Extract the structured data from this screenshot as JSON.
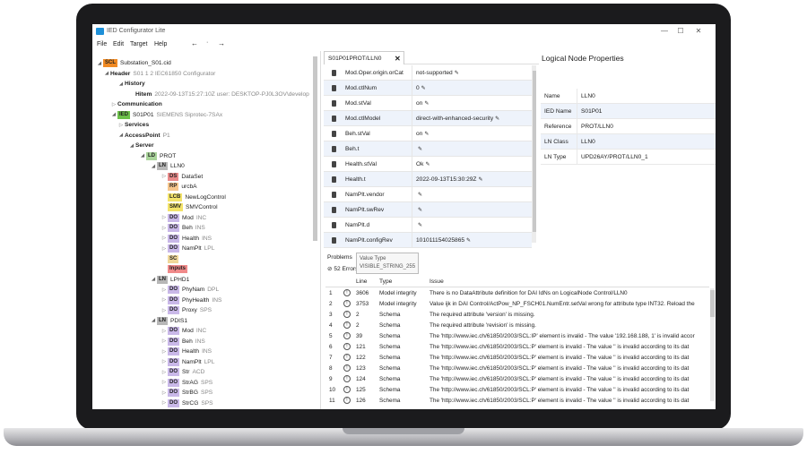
{
  "app": {
    "title": "IED Configurator Lite"
  },
  "window_controls": {
    "minimize": "—",
    "maximize": "☐",
    "close": "✕"
  },
  "menu": {
    "items": [
      "File",
      "Edit",
      "Target",
      "Help"
    ],
    "back": "←",
    "forward": "→"
  },
  "tree": [
    {
      "caret": "◢",
      "tag": "SCL",
      "tag_color": "#f08a24",
      "label": "Substation_S01.cid",
      "sub": "",
      "bold": false
    },
    {
      "caret": "◢",
      "tag": "",
      "tag_color": "",
      "label": "Header",
      "sub": "S01 1 2 IEC61850 Configurator",
      "bold": true
    },
    {
      "caret": "◢",
      "tag": "",
      "tag_color": "",
      "label": "History",
      "sub": "",
      "bold": true
    },
    {
      "caret": "",
      "tag": "",
      "tag_color": "",
      "label": "Hitem",
      "sub": "2022-09-13T15:27:10Z user: DESKTOP-PJ0L3OV\\develop",
      "bold": true
    },
    {
      "caret": "▷",
      "tag": "",
      "tag_color": "",
      "label": "Communication",
      "sub": "",
      "bold": true
    },
    {
      "caret": "◢",
      "tag": "IED",
      "tag_color": "#6cc04a",
      "label": "S01P01",
      "sub": "SIEMENS Siprotec-7SAx",
      "bold": false
    },
    {
      "caret": "▷",
      "tag": "",
      "tag_color": "",
      "label": "Services",
      "sub": "",
      "bold": true
    },
    {
      "caret": "◢",
      "tag": "",
      "tag_color": "",
      "label": "AccessPoint",
      "sub": "P1",
      "bold": true
    },
    {
      "caret": "◢",
      "tag": "",
      "tag_color": "",
      "label": "Server",
      "sub": "",
      "bold": true
    },
    {
      "caret": "◢",
      "tag": "LD",
      "tag_color": "#a9d49a",
      "label": "PROT",
      "sub": "",
      "bold": false
    },
    {
      "caret": "◢",
      "tag": "LN",
      "tag_color": "#b7b7b7",
      "label": "LLN0",
      "sub": "",
      "bold": false
    },
    {
      "caret": "▷",
      "tag": "DS",
      "tag_color": "#e98a8a",
      "label": "DataSet",
      "sub": "",
      "bold": false
    },
    {
      "caret": "",
      "tag": "RP",
      "tag_color": "#f6c68c",
      "label": "urcbA",
      "sub": "",
      "bold": false
    },
    {
      "caret": "",
      "tag": "LCB",
      "tag_color": "#f3e36a",
      "label": "NewLogControl",
      "sub": "",
      "bold": false
    },
    {
      "caret": "",
      "tag": "SMV",
      "tag_color": "#f3e36a",
      "label": "SMVControl",
      "sub": "",
      "bold": false
    },
    {
      "caret": "▷",
      "tag": "DO",
      "tag_color": "#c9b8e8",
      "label": "Mod",
      "sub": "INC",
      "bold": false
    },
    {
      "caret": "▷",
      "tag": "DO",
      "tag_color": "#c9b8e8",
      "label": "Beh",
      "sub": "INS",
      "bold": false
    },
    {
      "caret": "▷",
      "tag": "DO",
      "tag_color": "#c9b8e8",
      "label": "Health",
      "sub": "INS",
      "bold": false
    },
    {
      "caret": "▷",
      "tag": "DO",
      "tag_color": "#c9b8e8",
      "label": "NamPlt",
      "sub": "LPL",
      "bold": false
    },
    {
      "caret": "",
      "tag": "SC",
      "tag_color": "#f0d89a",
      "label": "",
      "sub": "",
      "bold": false
    },
    {
      "caret": "",
      "tag": "Inputs",
      "tag_color": "#f08a8a",
      "label": "",
      "sub": "",
      "bold": false
    },
    {
      "caret": "◢",
      "tag": "LN",
      "tag_color": "#b7b7b7",
      "label": "LPHD1",
      "sub": "",
      "bold": false
    },
    {
      "caret": "▷",
      "tag": "DO",
      "tag_color": "#c9b8e8",
      "label": "PhyNam",
      "sub": "DPL",
      "bold": false
    },
    {
      "caret": "▷",
      "tag": "DO",
      "tag_color": "#c9b8e8",
      "label": "PhyHealth",
      "sub": "INS",
      "bold": false
    },
    {
      "caret": "▷",
      "tag": "DO",
      "tag_color": "#c9b8e8",
      "label": "Proxy",
      "sub": "SPS",
      "bold": false
    },
    {
      "caret": "◢",
      "tag": "LN",
      "tag_color": "#b7b7b7",
      "label": "PDIS1",
      "sub": "",
      "bold": false
    },
    {
      "caret": "▷",
      "tag": "DO",
      "tag_color": "#c9b8e8",
      "label": "Mod",
      "sub": "INC",
      "bold": false
    },
    {
      "caret": "▷",
      "tag": "DO",
      "tag_color": "#c9b8e8",
      "label": "Beh",
      "sub": "INS",
      "bold": false
    },
    {
      "caret": "▷",
      "tag": "DO",
      "tag_color": "#c9b8e8",
      "label": "Health",
      "sub": "INS",
      "bold": false
    },
    {
      "caret": "▷",
      "tag": "DO",
      "tag_color": "#c9b8e8",
      "label": "NamPlt",
      "sub": "LPL",
      "bold": false
    },
    {
      "caret": "▷",
      "tag": "DO",
      "tag_color": "#c9b8e8",
      "label": "Str",
      "sub": "ACD",
      "bold": false
    },
    {
      "caret": "▷",
      "tag": "DO",
      "tag_color": "#c9b8e8",
      "label": "StrAG",
      "sub": "SPS",
      "bold": false
    },
    {
      "caret": "▷",
      "tag": "DO",
      "tag_color": "#c9b8e8",
      "label": "StrBG",
      "sub": "SPS",
      "bold": false
    },
    {
      "caret": "▷",
      "tag": "DO",
      "tag_color": "#c9b8e8",
      "label": "StrCG",
      "sub": "SPS",
      "bold": false
    }
  ],
  "editor": {
    "tab_label": "S01P01PROT/LLN0",
    "tab_close": "✕",
    "rows": [
      {
        "key": "Mod.Oper.origin.orCat",
        "value": "not-supported"
      },
      {
        "key": "Mod.ctlNum",
        "value": "0"
      },
      {
        "key": "Mod.stVal",
        "value": "on"
      },
      {
        "key": "Mod.ctlModel",
        "value": "direct-with-enhanced-security"
      },
      {
        "key": "Beh.stVal",
        "value": "on"
      },
      {
        "key": "Beh.t",
        "value": ""
      },
      {
        "key": "Health.stVal",
        "value": "Ok"
      },
      {
        "key": "Health.t",
        "value": "2022-09-13T15:30:29Z"
      },
      {
        "key": "NamPlt.vendor",
        "value": ""
      },
      {
        "key": "NamPlt.swRev",
        "value": ""
      },
      {
        "key": "NamPlt.d",
        "value": ""
      },
      {
        "key": "NamPlt.configRev",
        "value": "101011154025865"
      }
    ],
    "pen": "✎"
  },
  "tooltip": {
    "title": "Value Type",
    "value": "VISIBLE_STRING_255"
  },
  "properties": {
    "title": "Logical Node Properties",
    "rows": [
      {
        "key": "Name",
        "value": "LLN0"
      },
      {
        "key": "IED Name",
        "value": "S01P01"
      },
      {
        "key": "Reference",
        "value": "PROT/LLN0"
      },
      {
        "key": "LN Class",
        "value": "LLN0"
      },
      {
        "key": "LN Type",
        "value": "UPD26AY/PROT/LLN0_1"
      }
    ]
  },
  "problems": {
    "tab_label": "Problems",
    "error_count": "52 Errors",
    "headers": {
      "line": "Line",
      "type": "Type",
      "issue": "Issue"
    },
    "rows": [
      {
        "n": "1",
        "line": "3606",
        "type": "Model integrity",
        "issue": "There is no DataAttribute definition for DAI IdNs on LogicalNode Control/LLN0"
      },
      {
        "n": "2",
        "line": "3753",
        "type": "Model integrity",
        "issue": "Value ijk in DAI Control/ActPow_NP_FSCH01.NumEntr.setVal wrong for attribute type INT32. Reload the"
      },
      {
        "n": "3",
        "line": "2",
        "type": "Schema",
        "issue": "The required attribute 'version' is missing."
      },
      {
        "n": "4",
        "line": "2",
        "type": "Schema",
        "issue": "The required attribute 'revision' is missing."
      },
      {
        "n": "5",
        "line": "39",
        "type": "Schema",
        "issue": "The 'http://www.iec.ch/61850/2003/SCL:IP' element is invalid - The value '192.168.188, 1' is invalid accor"
      },
      {
        "n": "6",
        "line": "121",
        "type": "Schema",
        "issue": "The 'http://www.iec.ch/61850/2003/SCL:P' element is invalid - The value '' is invalid according to its dat"
      },
      {
        "n": "7",
        "line": "122",
        "type": "Schema",
        "issue": "The 'http://www.iec.ch/61850/2003/SCL:P' element is invalid - The value '' is invalid according to its dat"
      },
      {
        "n": "8",
        "line": "123",
        "type": "Schema",
        "issue": "The 'http://www.iec.ch/61850/2003/SCL:P' element is invalid - The value '' is invalid according to its dat"
      },
      {
        "n": "9",
        "line": "124",
        "type": "Schema",
        "issue": "The 'http://www.iec.ch/61850/2003/SCL:P' element is invalid - The value '' is invalid according to its dat"
      },
      {
        "n": "10",
        "line": "125",
        "type": "Schema",
        "issue": "The 'http://www.iec.ch/61850/2003/SCL:P' element is invalid - The value '' is invalid according to its dat"
      },
      {
        "n": "11",
        "line": "126",
        "type": "Schema",
        "issue": "The 'http://www.iec.ch/61850/2003/SCL:P' element is invalid - The value '' is invalid according to its dat"
      }
    ]
  }
}
